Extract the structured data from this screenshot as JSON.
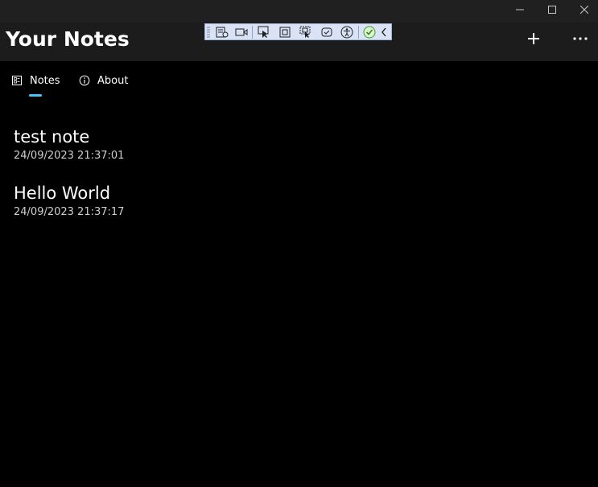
{
  "header": {
    "title": "Your Notes",
    "add_icon": "plus-icon",
    "more_icon": "more-ellipsis-icon"
  },
  "titlebar": {
    "icons": [
      "minimize-icon",
      "maximize-icon",
      "close-icon"
    ]
  },
  "debug_toolbar": {
    "icons": [
      "grip-icon",
      "live-visual-tree-icon",
      "record-icon",
      "select-element-icon",
      "display-layout-adorners-icon",
      "track-focus-icon",
      "hot-reload-icon",
      "accessibility-icon",
      "checkmark-icon",
      "collapse-chevron-icon"
    ]
  },
  "nav": {
    "items": [
      {
        "label": "Notes",
        "icon": "notes-icon",
        "selected": true
      },
      {
        "label": "About",
        "icon": "info-icon",
        "selected": false
      }
    ],
    "accent": "#4cc2ff"
  },
  "notes": [
    {
      "title": "test note",
      "date": "24/09/2023 21:37:01"
    },
    {
      "title": "Hello World",
      "date": "24/09/2023 21:37:17"
    }
  ]
}
